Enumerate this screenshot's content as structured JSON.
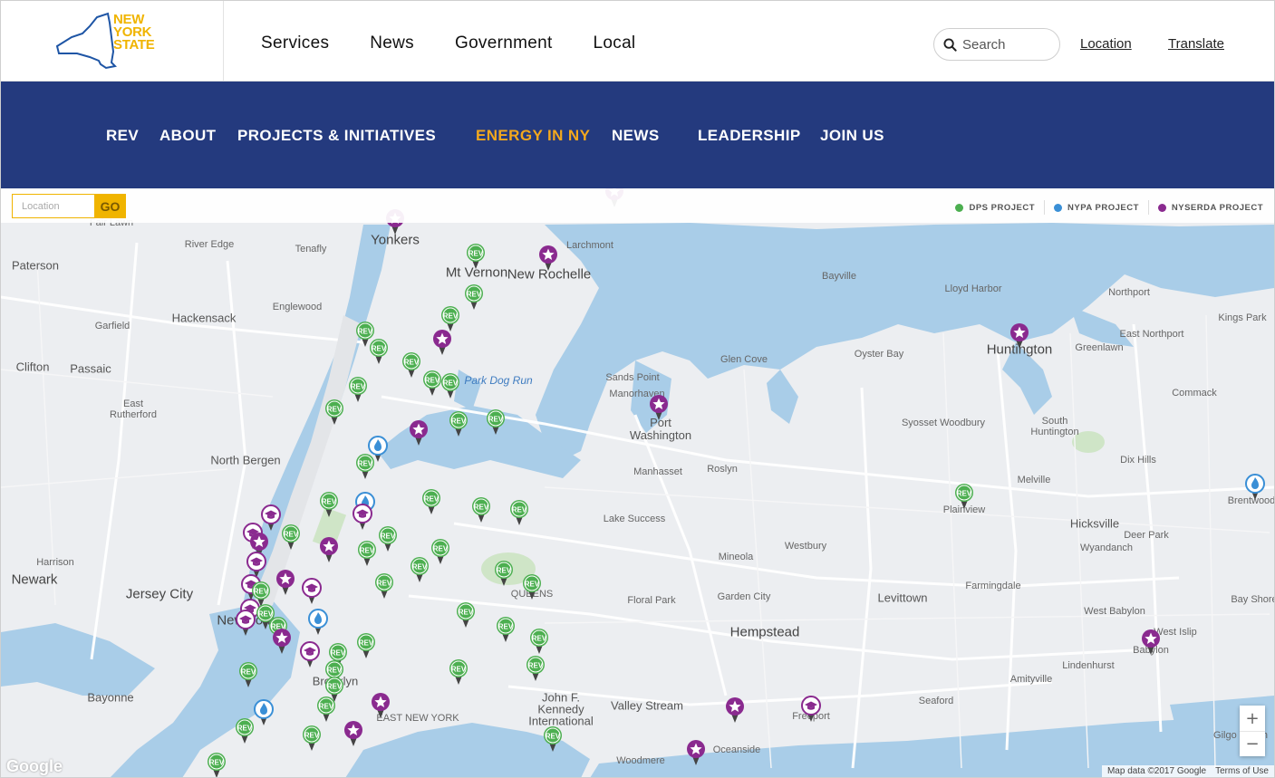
{
  "header": {
    "logo_lines": [
      "NEW",
      "YORK",
      "STATE"
    ],
    "nav": [
      "Services",
      "News",
      "Government",
      "Local"
    ],
    "search_placeholder": "Search",
    "location_label": "Location",
    "translate_label": "Translate"
  },
  "site_nav": {
    "items": [
      "REV",
      "ABOUT",
      "PROJECTS & INITIATIVES",
      "ENERGY IN NY",
      "NEWS",
      "LEADERSHIP",
      "JOIN US"
    ],
    "active": "ENERGY IN NY",
    "active_color": "#f3a81d",
    "bg_color": "#243a7e"
  },
  "map": {
    "location_placeholder": "Location",
    "go_label": "GO",
    "legend": [
      {
        "label": "DPS PROJECT",
        "color": "#4caf50"
      },
      {
        "label": "NYPA PROJECT",
        "color": "#3a8fd6"
      },
      {
        "label": "NYSERDA PROJECT",
        "color": "#8a2a8f"
      }
    ],
    "places": [
      {
        "name": "Yonkers",
        "size": "l"
      },
      {
        "name": "Larchmont",
        "size": "s"
      },
      {
        "name": "Mt Vernon",
        "size": "l"
      },
      {
        "name": "New Rochelle",
        "size": "l"
      },
      {
        "name": "Fair Lawn",
        "size": "s"
      },
      {
        "name": "River Edge",
        "size": "s"
      },
      {
        "name": "Tenafly",
        "size": "s"
      },
      {
        "name": "Paterson",
        "size": "m"
      },
      {
        "name": "Englewood",
        "size": "s"
      },
      {
        "name": "Garfield",
        "size": "s"
      },
      {
        "name": "Hackensack",
        "size": "m"
      },
      {
        "name": "Clifton",
        "size": "m"
      },
      {
        "name": "Passaic",
        "size": "m"
      },
      {
        "name": "East Rutherford",
        "size": "s"
      },
      {
        "name": "North Bergen",
        "size": "m"
      },
      {
        "name": "Harrison",
        "size": "s"
      },
      {
        "name": "Newark",
        "size": "l"
      },
      {
        "name": "Jersey City",
        "size": "l"
      },
      {
        "name": "Bayonne",
        "size": "m"
      },
      {
        "name": "Bayville",
        "size": "s"
      },
      {
        "name": "Lloyd Harbor",
        "size": "s"
      },
      {
        "name": "Northport",
        "size": "s"
      },
      {
        "name": "Kings Park",
        "size": "s"
      },
      {
        "name": "Huntington",
        "size": "l"
      },
      {
        "name": "Greenlawn",
        "size": "s"
      },
      {
        "name": "East Northport",
        "size": "s"
      },
      {
        "name": "Oyster Bay",
        "size": "s"
      },
      {
        "name": "Glen Cove",
        "size": "s"
      },
      {
        "name": "Sands Point",
        "size": "s"
      },
      {
        "name": "Manorhaven",
        "size": "s"
      },
      {
        "name": "Port Washington",
        "size": "m"
      },
      {
        "name": "Commack",
        "size": "s"
      },
      {
        "name": "Syosset Woodbury",
        "size": "s"
      },
      {
        "name": "South Huntington",
        "size": "s"
      },
      {
        "name": "Dix Hills",
        "size": "s"
      },
      {
        "name": "Manhasset",
        "size": "s"
      },
      {
        "name": "Roslyn",
        "size": "s"
      },
      {
        "name": "Melville",
        "size": "s"
      },
      {
        "name": "Plainview",
        "size": "s"
      },
      {
        "name": "Brentwood",
        "size": "s"
      },
      {
        "name": "Hicksville",
        "size": "m"
      },
      {
        "name": "Lake Success",
        "size": "s"
      },
      {
        "name": "Mineola",
        "size": "s"
      },
      {
        "name": "Westbury",
        "size": "s"
      },
      {
        "name": "Deer Park",
        "size": "s"
      },
      {
        "name": "Wyandanch",
        "size": "s"
      },
      {
        "name": "Farmingdale",
        "size": "s"
      },
      {
        "name": "Floral Park",
        "size": "s"
      },
      {
        "name": "Garden City",
        "size": "s"
      },
      {
        "name": "Levittown",
        "size": "m"
      },
      {
        "name": "West Babylon",
        "size": "s"
      },
      {
        "name": "Bay Shore",
        "size": "s"
      },
      {
        "name": "Hempstead",
        "size": "l"
      },
      {
        "name": "West Islip",
        "size": "s"
      },
      {
        "name": "Babylon",
        "size": "s"
      },
      {
        "name": "Lindenhurst",
        "size": "s"
      },
      {
        "name": "Amityville",
        "size": "s"
      },
      {
        "name": "Seaford",
        "size": "s"
      },
      {
        "name": "John F. Kennedy International Airport",
        "size": "m"
      },
      {
        "name": "Valley Stream",
        "size": "m"
      },
      {
        "name": "Freeport",
        "size": "s"
      },
      {
        "name": "Oceanside",
        "size": "s"
      },
      {
        "name": "Woodmere",
        "size": "s"
      },
      {
        "name": "Park Dog Run",
        "size": "w"
      },
      {
        "name": "QUEENS",
        "size": "s"
      },
      {
        "name": "New York",
        "size": "l"
      },
      {
        "name": "Brooklyn",
        "size": "m"
      },
      {
        "name": "EAST NEW YORK",
        "size": "s"
      },
      {
        "name": "Gilgo Beach",
        "size": "s"
      }
    ],
    "marker_counts": {
      "dps": 44,
      "nypa": 6,
      "nyserda": 16
    },
    "marker_badge_label": "REV",
    "google_label": "Google",
    "attribution": "Map data ©2017 Google",
    "terms": "Terms of Use",
    "zoom_in": "+",
    "zoom_out": "−"
  }
}
